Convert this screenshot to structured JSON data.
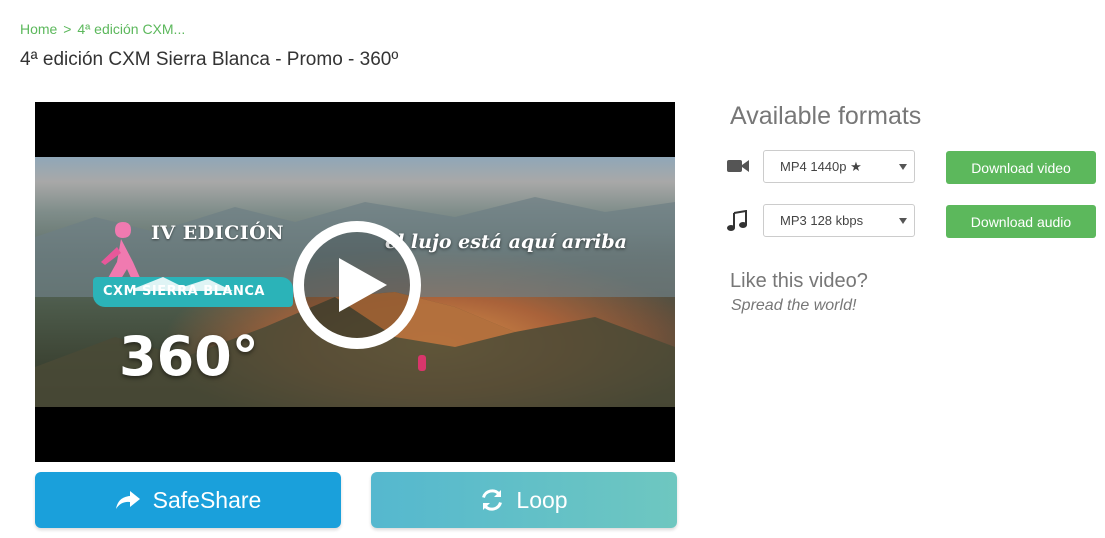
{
  "breadcrumb": {
    "home": "Home",
    "separator": ">",
    "current": "4ª edición CXM..."
  },
  "title": "4ª edición CXM Sierra Blanca - Promo - 360º",
  "video": {
    "overlay_edition": "IV EDICIÓN",
    "overlay_name": "CXM SIERRA BLANCA",
    "overlay_360": "360°",
    "overlay_tagline": "el lujo está aquí arriba",
    "play_icon": "play-icon"
  },
  "actions": {
    "safeshare_label": "SafeShare",
    "safeshare_icon": "share-arrow-icon",
    "loop_label": "Loop",
    "loop_icon": "refresh-icon"
  },
  "formats": {
    "heading": "Available formats",
    "video": {
      "icon": "video-camera-icon",
      "selected": "MP4 1440p ★",
      "button": "Download video"
    },
    "audio": {
      "icon": "music-note-icon",
      "selected": "MP3 128 kbps",
      "button": "Download audio"
    }
  },
  "like": {
    "heading": "Like this video?",
    "subtext": "Spread the world!"
  },
  "colors": {
    "green": "#5cb85c",
    "blue": "#1aa0db",
    "teal": "#6ec7c0"
  }
}
